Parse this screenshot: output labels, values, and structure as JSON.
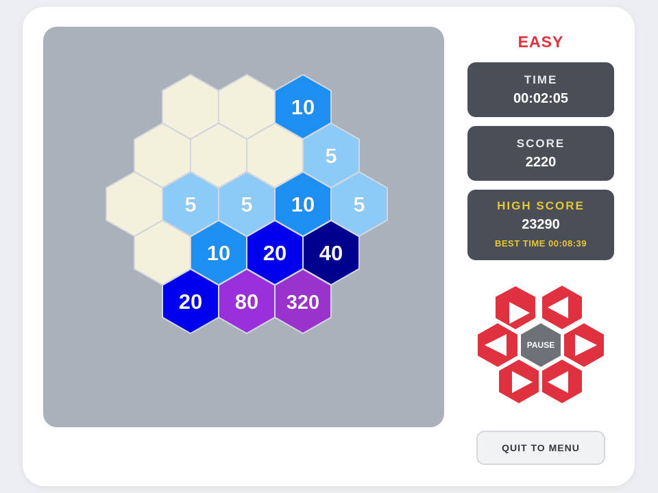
{
  "difficulty": "EASY",
  "stats": {
    "time_label": "TIME",
    "time_value": "00:02:05",
    "score_label": "SCORE",
    "score_value": "2220",
    "high_label": "HIGH SCORE",
    "high_value": "23290",
    "best_time": "BEST TIME 00:08:39"
  },
  "controls": {
    "pause_label": "PAUSE"
  },
  "quit_label": "QUIT TO MENU",
  "colors": {
    "empty": "#f3f0dc",
    "5": "#8ccaf7",
    "10": "#1e8ff2",
    "20": "#0000ee",
    "40": "#00008f",
    "80": "#9a30dc",
    "320": "#9933cc",
    "accent": "#e0313e",
    "panel": "#4a4f57"
  },
  "board": {
    "rows": [
      [
        "",
        "",
        "10"
      ],
      [
        "",
        "",
        "",
        "5"
      ],
      [
        "",
        "5",
        "5",
        "10",
        "5"
      ],
      [
        "",
        "10",
        "20",
        "40"
      ],
      [
        "20",
        "80",
        "320"
      ]
    ]
  }
}
